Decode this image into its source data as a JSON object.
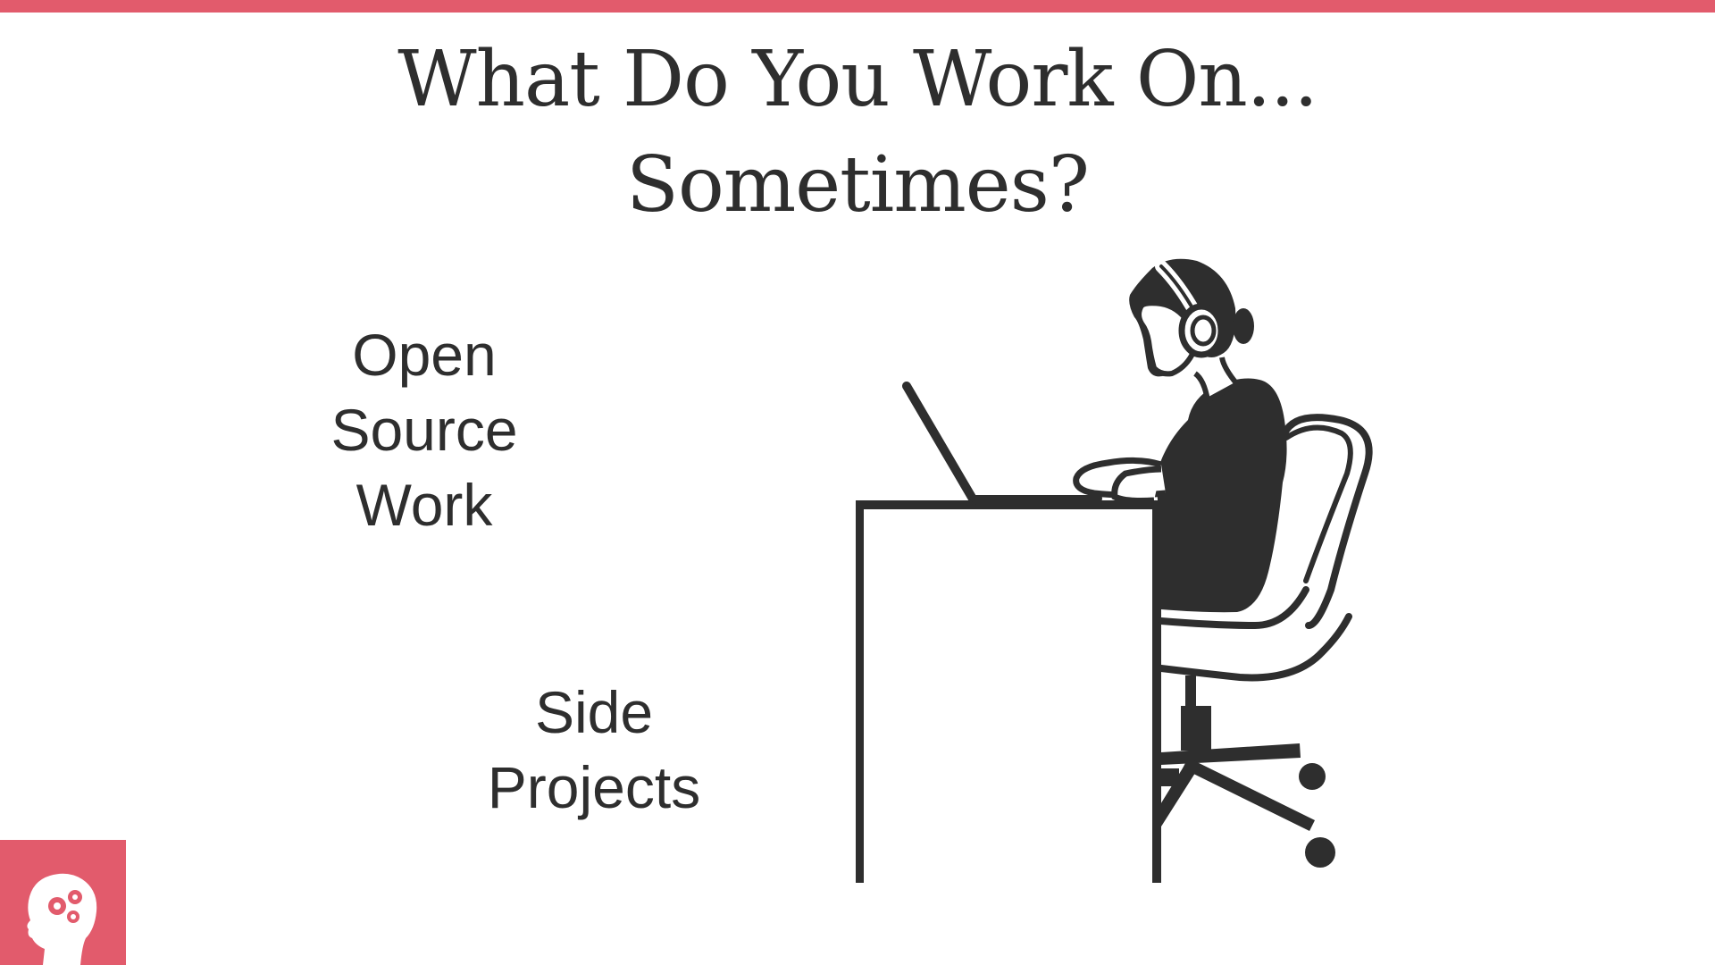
{
  "slide": {
    "title_line1": "What Do You Work On...",
    "title_line2": "Sometimes?",
    "label_open_source": [
      "Open",
      "Source",
      "Work"
    ],
    "label_side_projects": [
      "Side",
      "Projects"
    ]
  },
  "colors": {
    "accent": "#e25b6c",
    "text": "#2e2e2e",
    "background": "#ffffff"
  },
  "icons": {
    "illustration": "person-at-desk-with-headphones-and-laptop",
    "logo": "head-with-gears-icon"
  }
}
